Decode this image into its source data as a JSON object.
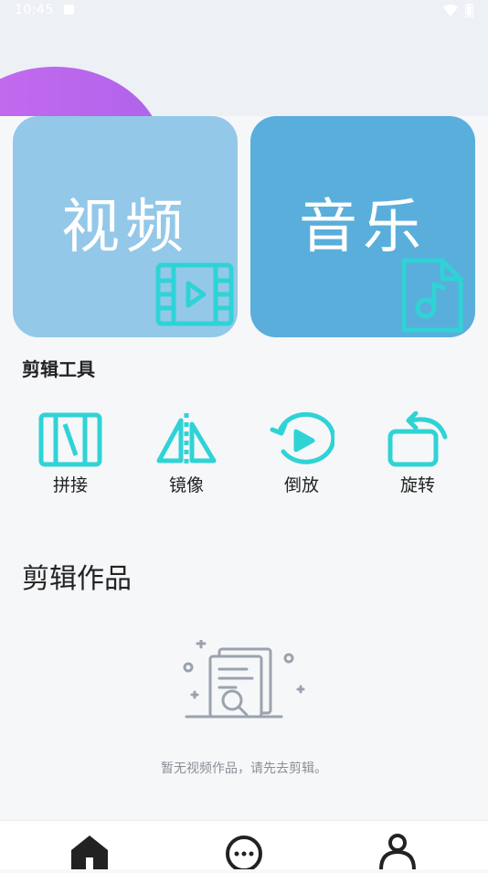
{
  "status_bar": {
    "time": "10:45"
  },
  "cards": [
    {
      "title": "视频",
      "icon": "film-play-icon"
    },
    {
      "title": "音乐",
      "icon": "music-file-icon"
    }
  ],
  "tools_section": {
    "title": "剪辑工具",
    "items": [
      {
        "label": "拼接",
        "icon": "splice-icon"
      },
      {
        "label": "镜像",
        "icon": "mirror-icon"
      },
      {
        "label": "倒放",
        "icon": "reverse-play-icon"
      },
      {
        "label": "旋转",
        "icon": "rotate-icon"
      }
    ]
  },
  "works_section": {
    "title": "剪辑作品",
    "empty_text": "暂无视频作品，请先去剪辑。"
  },
  "bottom_nav": [
    {
      "icon": "home-icon"
    },
    {
      "icon": "chat-icon"
    },
    {
      "icon": "profile-icon"
    }
  ],
  "colors": {
    "accent": "#2fd3d6",
    "video_card": "#93c8e9",
    "music_card": "#5aaedb"
  }
}
